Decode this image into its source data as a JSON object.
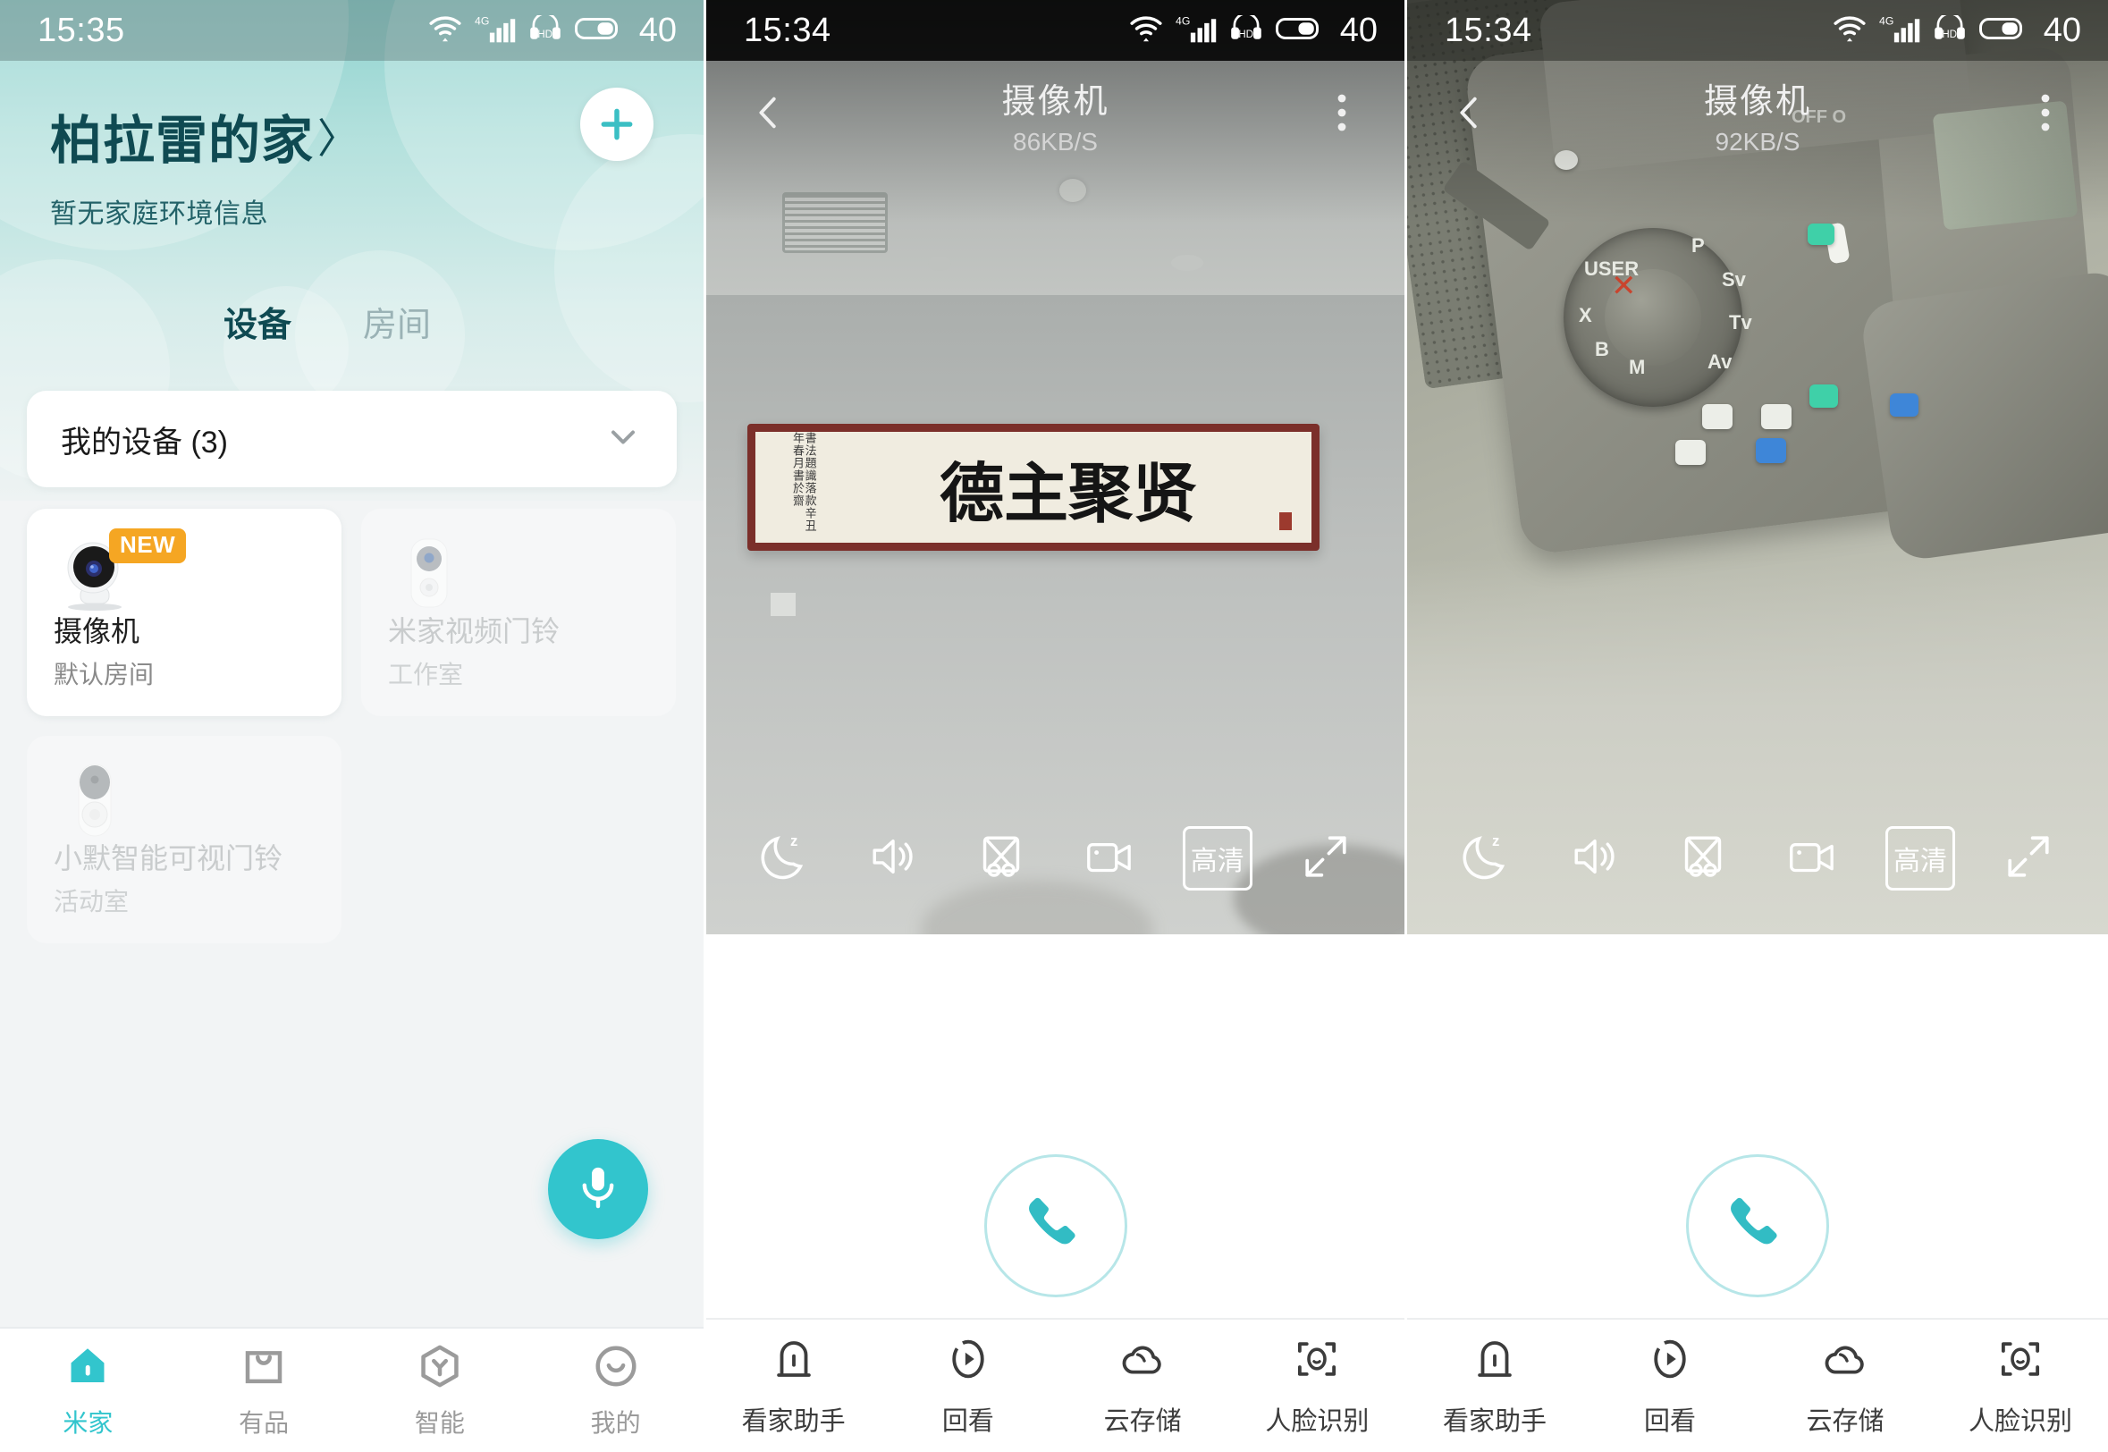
{
  "panel_home": {
    "status_bar": {
      "time": "15:35",
      "network": "4G",
      "hd": "HD",
      "battery": "40"
    },
    "header": {
      "home_name": "柏拉雷的家",
      "chevron": "〉",
      "subtitle": "暂无家庭环境信息",
      "add_button_name": "add-device-button"
    },
    "tabs": [
      {
        "label": "设备",
        "active": true
      },
      {
        "label": "房间",
        "active": false
      }
    ],
    "group": {
      "label": "我的设备 (3)"
    },
    "devices": [
      {
        "name": "摄像机",
        "room": "默认房间",
        "badge": "NEW",
        "offline": false,
        "icon": "camera-device-icon"
      },
      {
        "name": "米家视频门铃",
        "room": "工作室",
        "badge": "",
        "offline": true,
        "icon": "doorbell-device-icon"
      },
      {
        "name": "小默智能可视门铃",
        "room": "活动室",
        "badge": "",
        "offline": true,
        "icon": "doorbell2-device-icon"
      }
    ],
    "voice_fab": {
      "name": "voice-assistant-button",
      "icon": "microphone-icon"
    },
    "bottom_nav": [
      {
        "label": "米家",
        "icon": "home-icon",
        "active": true
      },
      {
        "label": "有品",
        "icon": "shopping-bag-icon",
        "active": false
      },
      {
        "label": "智能",
        "icon": "automation-hexagon-icon",
        "active": false
      },
      {
        "label": "我的",
        "icon": "profile-smiley-icon",
        "active": false
      }
    ],
    "colors": {
      "accent": "#32c5cd",
      "header_text": "#0f4a52",
      "badge": "#f5a623"
    }
  },
  "panel_camera_mid": {
    "status_bar": {
      "time": "15:34",
      "network": "4G",
      "hd": "HD",
      "battery": "40"
    },
    "top_bar": {
      "title": "摄像机",
      "bitrate": "86KB/S",
      "back_icon": "chevron-left-icon",
      "more_icon": "more-vertical-icon"
    },
    "toolbar": [
      {
        "icon": "sleep-moon-icon",
        "label": ""
      },
      {
        "icon": "volume-icon",
        "label": ""
      },
      {
        "icon": "screenshot-scissors-icon",
        "label": ""
      },
      {
        "icon": "record-video-icon",
        "label": ""
      },
      {
        "icon": "quality-badge",
        "label": "高清"
      },
      {
        "icon": "fullscreen-expand-icon",
        "label": ""
      }
    ],
    "call_button": {
      "name": "voice-call-button",
      "icon": "phone-icon"
    },
    "feature_nav": [
      {
        "label": "看家助手",
        "icon": "home-guard-icon"
      },
      {
        "label": "回看",
        "icon": "playback-icon"
      },
      {
        "label": "云存储",
        "icon": "cloud-storage-icon"
      },
      {
        "label": "人脸识别",
        "icon": "face-recognition-icon"
      }
    ]
  },
  "panel_camera_right": {
    "status_bar": {
      "time": "15:34",
      "network": "4G",
      "hd": "HD",
      "battery": "40"
    },
    "top_bar": {
      "title": "摄像机",
      "bitrate": "92KB/S",
      "back_icon": "chevron-left-icon",
      "more_icon": "more-vertical-icon"
    },
    "toolbar": [
      {
        "icon": "sleep-moon-icon",
        "label": ""
      },
      {
        "icon": "volume-icon",
        "label": ""
      },
      {
        "icon": "screenshot-scissors-icon",
        "label": ""
      },
      {
        "icon": "record-video-icon",
        "label": ""
      },
      {
        "icon": "quality-badge",
        "label": "高清"
      },
      {
        "icon": "fullscreen-expand-icon",
        "label": ""
      }
    ],
    "call_button": {
      "name": "voice-call-button",
      "icon": "phone-icon"
    },
    "feature_nav": [
      {
        "label": "看家助手",
        "icon": "home-guard-icon"
      },
      {
        "label": "回看",
        "icon": "playback-icon"
      },
      {
        "label": "云存储",
        "icon": "cloud-storage-icon"
      },
      {
        "label": "人脸识别",
        "icon": "face-recognition-icon"
      }
    ]
  },
  "scene_text": {
    "plaque_calligraphy": "德主聚贤"
  }
}
